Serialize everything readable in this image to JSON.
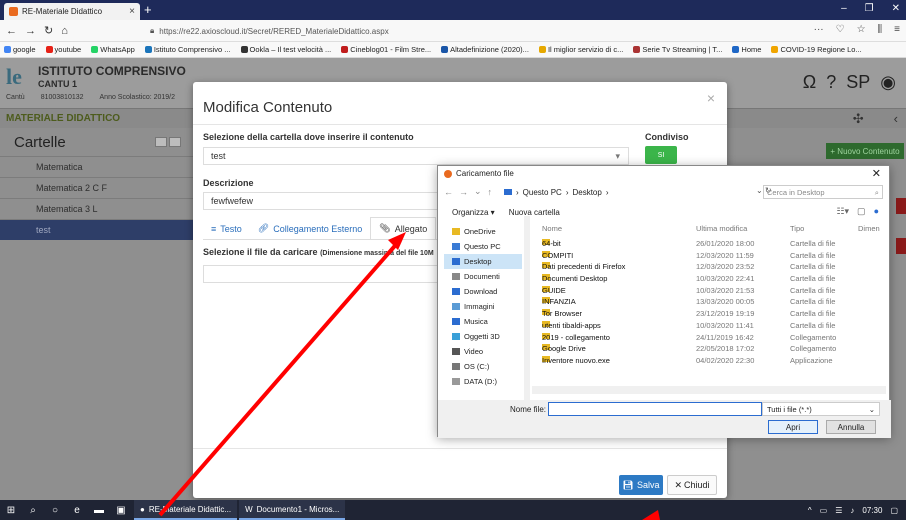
{
  "browser": {
    "tab_title": "RE-Materiale Didattico",
    "new_tab": "+",
    "url": "https://re22.axioscloud.it/Secret/RERED_MaterialeDidattico.aspx",
    "bookmarks": [
      {
        "label": "google",
        "color": "#4285f4"
      },
      {
        "label": "youtube",
        "color": "#e62117"
      },
      {
        "label": "WhatsApp",
        "color": "#25d366"
      },
      {
        "label": "Istituto Comprensivo ...",
        "color": "#1b75bb"
      },
      {
        "label": "Ookla – Il test velocità ...",
        "color": "#333333"
      },
      {
        "label": "Cineblog01 - Film Stre...",
        "color": "#c01c1c"
      },
      {
        "label": "Altadefinizione (2020)...",
        "color": "#1a56a8"
      },
      {
        "label": "Il miglior servizio di c...",
        "color": "#e6a800"
      },
      {
        "label": "Serie Tv Streaming | T...",
        "color": "#aa3333"
      },
      {
        "label": "Home",
        "color": "#1f67c6"
      },
      {
        "label": "COVID-19 Regione Lo...",
        "color": "#f0a500"
      }
    ]
  },
  "site": {
    "school_name": "ISTITUTO COMPRENSIVO",
    "school_city": "CANTU 1",
    "school_code": "81003810132",
    "school_prefix": "Cantù",
    "year_label": "Anno Scolastico: 2019/2",
    "section_title": "MATERIALE DIDATTICO",
    "new_content_button": "+ Nuovo Contenuto"
  },
  "folders": {
    "title": "Cartelle",
    "items": [
      "Matematica",
      "Matematica 2 C F",
      "Matematica 3 L",
      "test"
    ]
  },
  "modal": {
    "title": "Modifica Contenuto",
    "close": "×",
    "folder_label": "Selezione della cartella dove inserire il contenuto",
    "folder_value": "test",
    "shared_label": "Condiviso",
    "shared_toggle": "SI",
    "description_label": "Descrizione",
    "description_value": "fewfwefew",
    "tabs": [
      {
        "label": "Testo",
        "icon": "text-icon"
      },
      {
        "label": "Collegamento Esterno",
        "icon": "link-icon"
      },
      {
        "label": "Allegato",
        "icon": "paperclip-icon"
      }
    ],
    "file_label": "Selezione il file da caricare",
    "file_hint": "(Dimensione massima del file 10M",
    "save_button": "Salva",
    "close_button": "Chiudi"
  },
  "file_dialog": {
    "title": "Caricamento file",
    "breadcrumb": [
      "Questo PC",
      "Desktop"
    ],
    "search_placeholder": "Cerca in Desktop",
    "organize": "Organizza ▾",
    "new_folder": "Nuova cartella",
    "sidebar": [
      {
        "label": "OneDrive",
        "color": "#e8b923"
      },
      {
        "label": "Questo PC",
        "color": "#3a7bd5"
      },
      {
        "label": "Desktop",
        "color": "#2b6cd0",
        "selected": true
      },
      {
        "label": "Documenti",
        "color": "#888888"
      },
      {
        "label": "Download",
        "color": "#2b6cd0"
      },
      {
        "label": "Immagini",
        "color": "#5b9bd5"
      },
      {
        "label": "Musica",
        "color": "#2b6cd0"
      },
      {
        "label": "Oggetti 3D",
        "color": "#3aa0d8"
      },
      {
        "label": "Video",
        "color": "#555555"
      },
      {
        "label": "OS (C:)",
        "color": "#777777"
      },
      {
        "label": "DATA (D:)",
        "color": "#999999"
      }
    ],
    "columns": [
      "Nome",
      "Ultima modifica",
      "Tipo",
      "Dimen"
    ],
    "rows": [
      {
        "name": "64-bit",
        "date": "26/01/2020 18:00",
        "type": "Cartella di file"
      },
      {
        "name": "COMPITI",
        "date": "12/03/2020 11:59",
        "type": "Cartella di file"
      },
      {
        "name": "Dati precedenti di Firefox",
        "date": "12/03/2020 23:52",
        "type": "Cartella di file"
      },
      {
        "name": "Documenti Desktop",
        "date": "10/03/2020 22:41",
        "type": "Cartella di file"
      },
      {
        "name": "GUIDE",
        "date": "10/03/2020 21:53",
        "type": "Cartella di file"
      },
      {
        "name": "INFANZIA",
        "date": "13/03/2020 00:05",
        "type": "Cartella di file"
      },
      {
        "name": "Tor Browser",
        "date": "23/12/2019 19:19",
        "type": "Cartella di file"
      },
      {
        "name": "utenti tibaldi-apps",
        "date": "10/03/2020 11:41",
        "type": "Cartella di file"
      },
      {
        "name": "2019 - collegamento",
        "date": "24/11/2019 16:42",
        "type": "Collegamento"
      },
      {
        "name": "Google Drive",
        "date": "22/05/2018 17:02",
        "type": "Collegamento"
      },
      {
        "name": "Inventore nuovo.exe",
        "date": "04/02/2020 22:30",
        "type": "Applicazione"
      }
    ],
    "filename_label": "Nome file:",
    "filetype_value": "Tutti i file (*.*)",
    "open_button": "Apri",
    "cancel_button": "Annulla"
  },
  "taskbar": {
    "apps": [
      "RE-Materiale Didattic...",
      "Documento1 - Micros..."
    ],
    "time": "07:30"
  },
  "colors": {
    "annotation_arrow": "#ff0000"
  }
}
